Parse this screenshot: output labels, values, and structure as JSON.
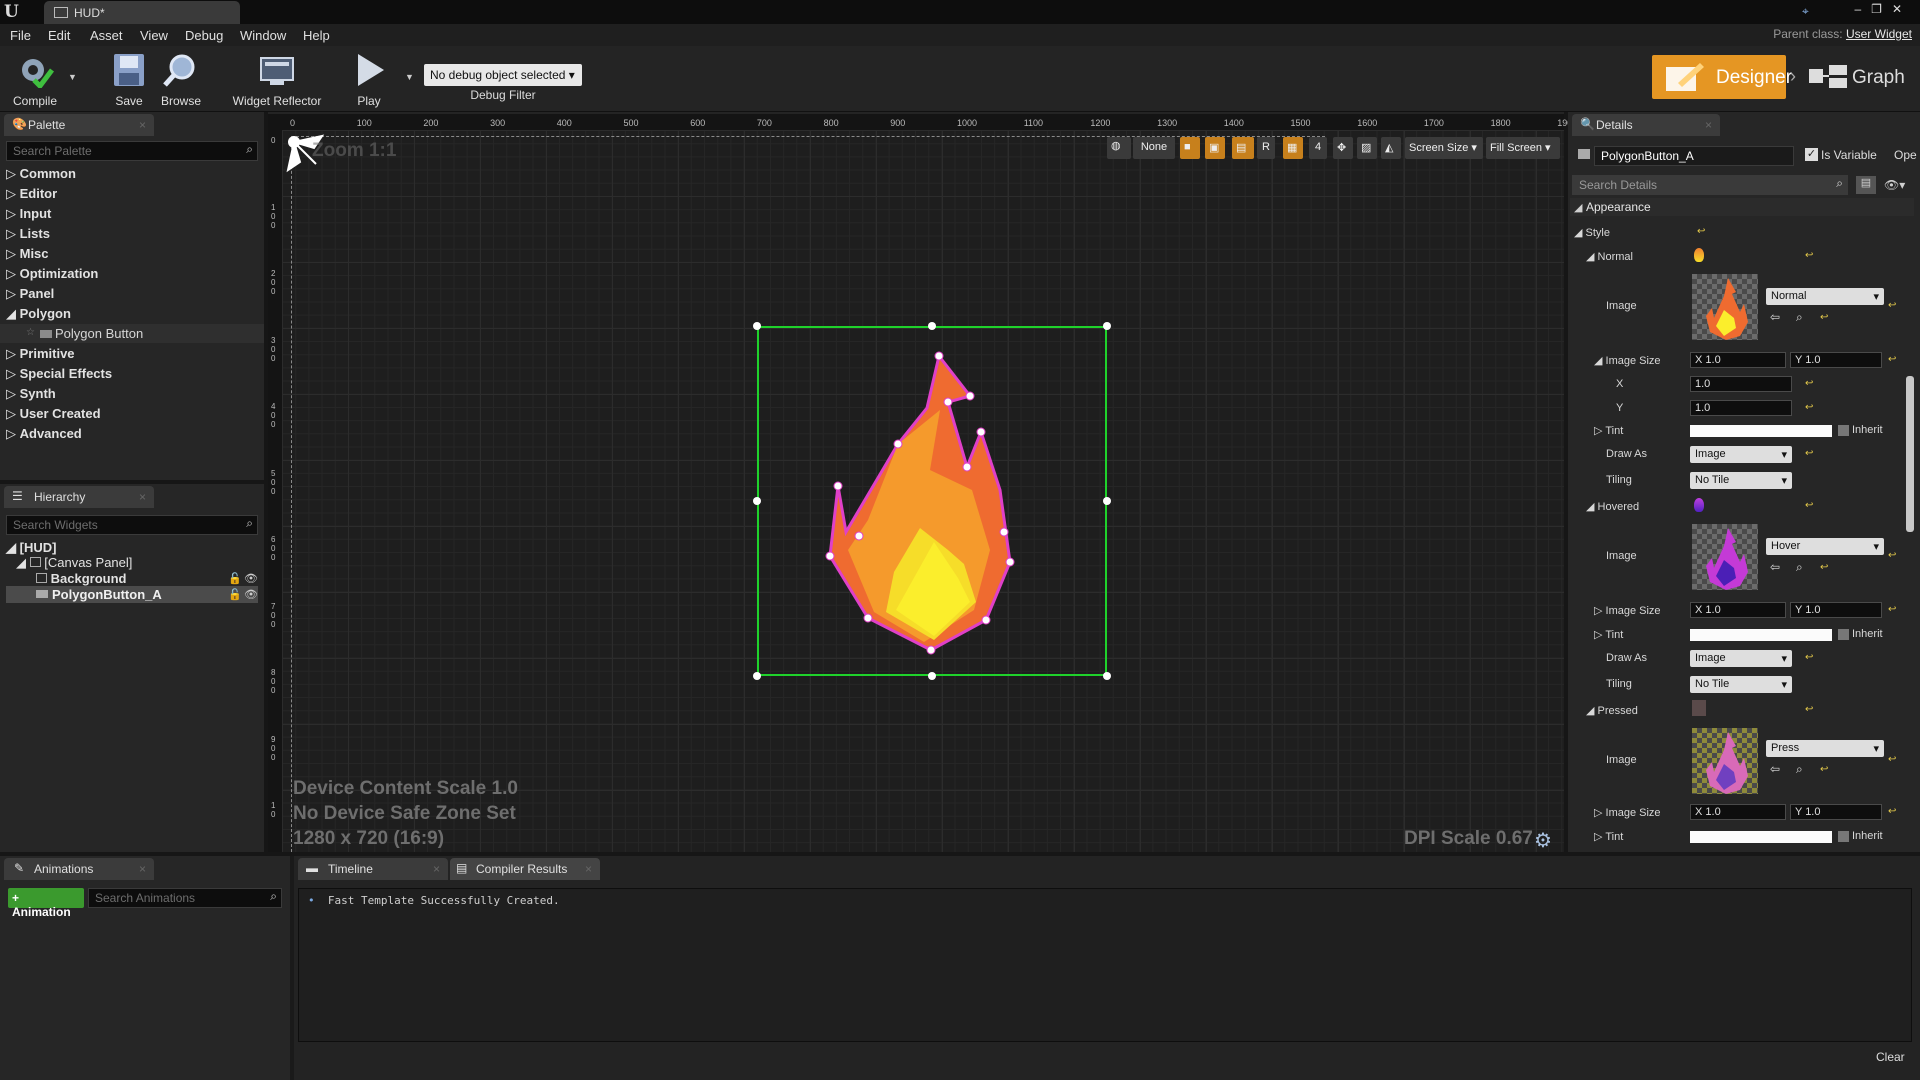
{
  "app": {
    "tab_title": "HUD*",
    "logo": "U",
    "parent_class_label": "Parent class:",
    "parent_class_value": "User Widget"
  },
  "menu": [
    "File",
    "Edit",
    "Asset",
    "View",
    "Debug",
    "Window",
    "Help"
  ],
  "toolbar": {
    "compile": "Compile",
    "save": "Save",
    "browse": "Browse",
    "widget_reflector": "Widget Reflector",
    "play": "Play",
    "debug_select": "No debug object selected",
    "debug_filter": "Debug Filter",
    "designer": "Designer",
    "graph": "Graph"
  },
  "palette": {
    "tab": "Palette",
    "search_placeholder": "Search Palette",
    "categories": [
      "Common",
      "Editor",
      "Input",
      "Lists",
      "Misc",
      "Optimization",
      "Panel",
      "Polygon",
      "Primitive",
      "Special Effects",
      "Synth",
      "User Created",
      "Advanced"
    ],
    "polygon_child": "Polygon Button"
  },
  "hierarchy": {
    "tab": "Hierarchy",
    "search_placeholder": "Search Widgets",
    "root": "[HUD]",
    "canvas": "[Canvas Panel]",
    "background": "Background",
    "button": "PolygonButton_A"
  },
  "animations": {
    "tab": "Animations",
    "add_button": "+ Animation",
    "search_placeholder": "Search Animations"
  },
  "viewport": {
    "zoom": "Zoom 1:1",
    "ruler_ticks": [
      "0",
      "100",
      "200",
      "300",
      "400",
      "500",
      "600",
      "700",
      "800",
      "900",
      "1000",
      "1100",
      "1200",
      "1300",
      "1400",
      "1500",
      "1600",
      "1700",
      "1800",
      "190"
    ],
    "ruler_left": [
      "0",
      "1 0 0",
      "2 0 0",
      "3 0 0",
      "4 0 0",
      "5 0 0",
      "6 0 0",
      "7 0 0",
      "8 0 0",
      "9 0 0",
      "1 0"
    ],
    "toolbar": {
      "none": "None",
      "r": "R",
      "four": "4",
      "screen_size": "Screen Size",
      "fill_screen": "Fill Screen"
    },
    "info1": "Device Content Scale 1.0",
    "info2": "No Device Safe Zone Set",
    "info3": "1280 x 720 (16:9)",
    "dpi": "DPI Scale 0.67",
    "selection_color": "#1fd22b",
    "flame_outline": "#e040c8"
  },
  "details": {
    "tab": "Details",
    "widget_name": "PolygonButton_A",
    "is_variable": "Is Variable",
    "open": "Ope",
    "search_placeholder": "Search Details",
    "appearance": "Appearance",
    "style": "Style",
    "states": [
      {
        "name": "Normal",
        "image_label": "Image",
        "asset": "Normal",
        "size_label": "Image Size",
        "x": "X 1.0",
        "y": "Y 1.0",
        "x_label": "X",
        "x_val": "1.0",
        "y_label": "Y",
        "y_val": "1.0",
        "tint": "Tint",
        "inherit": "Inherit",
        "draw_as_label": "Draw As",
        "draw_as": "Image",
        "tiling_label": "Tiling",
        "tiling": "No Tile"
      },
      {
        "name": "Hovered",
        "image_label": "Image",
        "asset": "Hover",
        "size_label": "Image Size",
        "x": "X 1.0",
        "y": "Y 1.0",
        "tint": "Tint",
        "inherit": "Inherit",
        "draw_as_label": "Draw As",
        "draw_as": "Image",
        "tiling_label": "Tiling",
        "tiling": "No Tile"
      },
      {
        "name": "Pressed",
        "image_label": "Image",
        "asset": "Press",
        "size_label": "Image Size",
        "x": "X 1.0",
        "y": "Y 1.0",
        "tint": "Tint",
        "inherit": "Inherit"
      }
    ]
  },
  "bottom": {
    "timeline_tab": "Timeline",
    "compiler_tab": "Compiler Results",
    "message": "Fast Template Successfully Created.",
    "clear": "Clear"
  },
  "colors": {
    "accent": "#e59623",
    "panel": "#262626",
    "add_green": "#3b9a2e"
  }
}
